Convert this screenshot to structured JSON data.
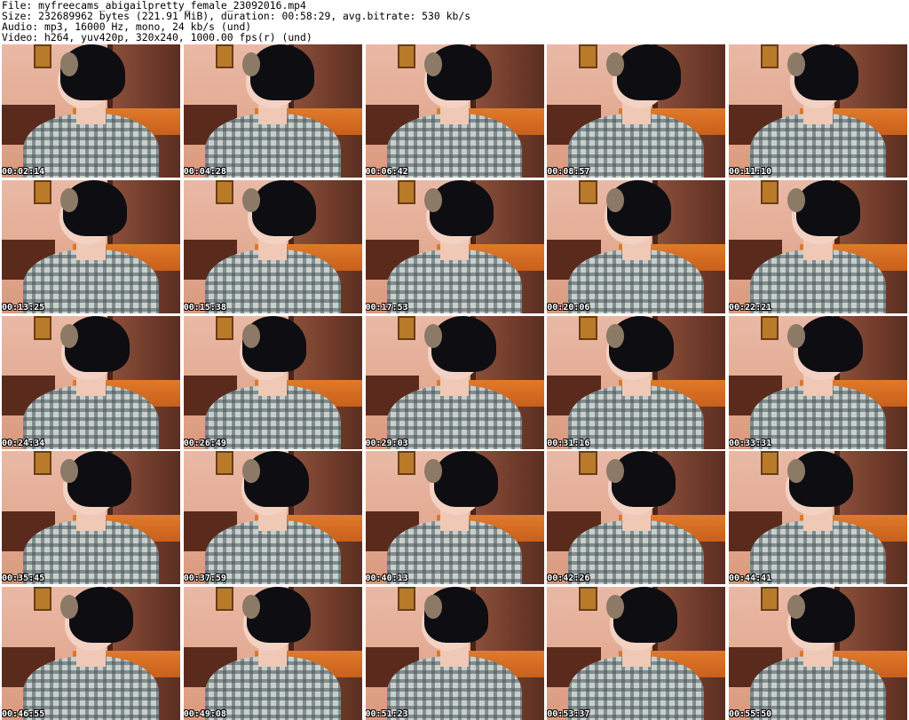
{
  "info": {
    "file": "File: myfreecams_abigailpretty_female_23092016.mp4",
    "size": "Size: 232689962 bytes (221.91 MiB), duration: 00:58:29, avg.bitrate: 530 kb/s",
    "audio": "Audio: mp3, 16000 Hz, mono, 24 kb/s (und)",
    "video": "Video: h264, yuv420p, 320x240, 1000.00 fps(r) (und)"
  },
  "thumbnails": [
    {
      "timestamp": "00:02:14"
    },
    {
      "timestamp": "00:04:28"
    },
    {
      "timestamp": "00:06:42"
    },
    {
      "timestamp": "00:08:57"
    },
    {
      "timestamp": "00:11:10"
    },
    {
      "timestamp": "00:13:25"
    },
    {
      "timestamp": "00:15:38"
    },
    {
      "timestamp": "00:17:53"
    },
    {
      "timestamp": "00:20:06"
    },
    {
      "timestamp": "00:22:21"
    },
    {
      "timestamp": "00:24:34"
    },
    {
      "timestamp": "00:26:49"
    },
    {
      "timestamp": "00:29:03"
    },
    {
      "timestamp": "00:31:16"
    },
    {
      "timestamp": "00:33:31"
    },
    {
      "timestamp": "00:35:45"
    },
    {
      "timestamp": "00:37:59"
    },
    {
      "timestamp": "00:40:13"
    },
    {
      "timestamp": "00:42:26"
    },
    {
      "timestamp": "00:44:41"
    },
    {
      "timestamp": "00:46:55"
    },
    {
      "timestamp": "00:49:08"
    },
    {
      "timestamp": "00:51:23"
    },
    {
      "timestamp": "00:53:37"
    },
    {
      "timestamp": "00:55:50"
    }
  ],
  "colors": {
    "background": "#ffffff",
    "text": "#000000",
    "timestamp": "#ffffff"
  }
}
